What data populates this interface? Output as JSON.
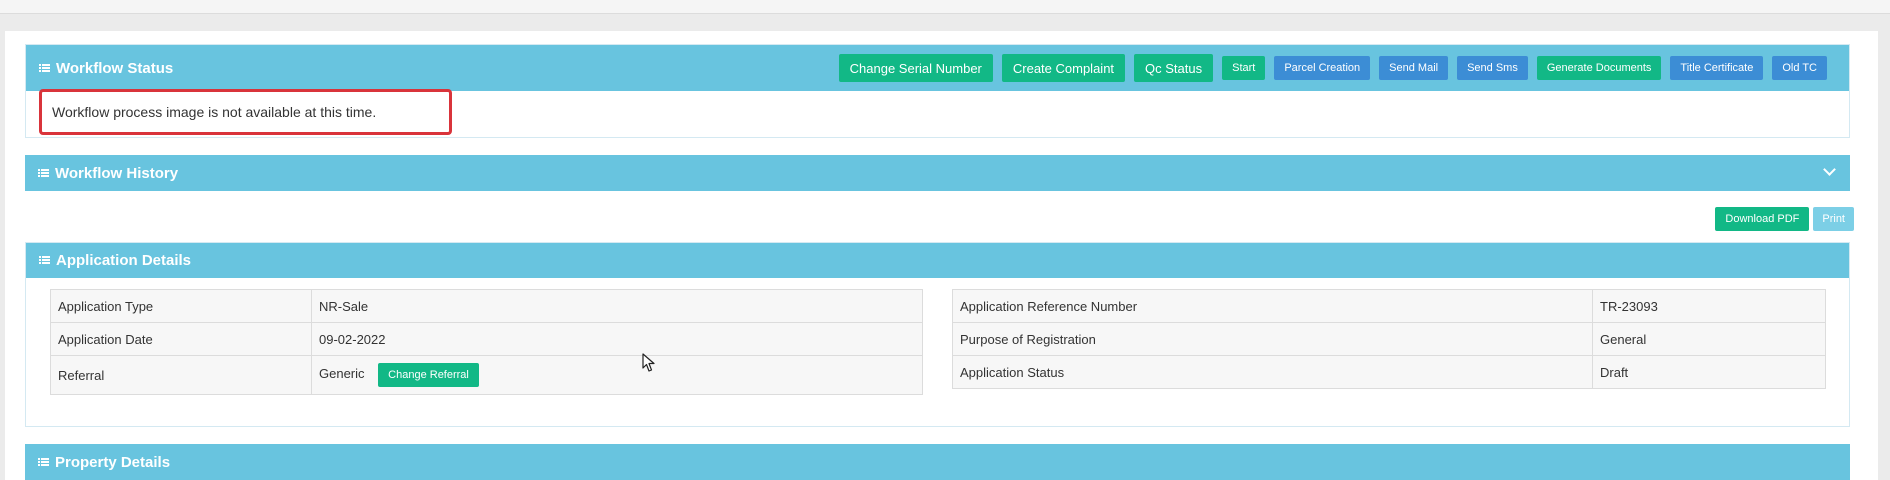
{
  "workflow_status": {
    "title": "Workflow Status",
    "message": "Workflow process image is not available at this time.",
    "buttons": {
      "change_serial": "Change Serial Number",
      "create_complaint": "Create Complaint",
      "qc_status": "Qc Status",
      "start": "Start",
      "parcel_creation": "Parcel Creation",
      "send_mail": "Send Mail",
      "send_sms": "Send Sms",
      "generate_documents": "Generate Documents",
      "title_certificate": "Title Certificate",
      "old_tc": "Old TC"
    }
  },
  "workflow_history": {
    "title": "Workflow History",
    "toggle_icon": "chevron-down-icon"
  },
  "doc_actions": {
    "download_pdf": "Download PDF",
    "print": "Print"
  },
  "application_details": {
    "title": "Application Details",
    "left": [
      {
        "label": "Application Type",
        "value": "NR-Sale"
      },
      {
        "label": "Application Date",
        "value": "09-02-2022"
      },
      {
        "label": "Referral",
        "value": "Generic",
        "action": "Change Referral"
      }
    ],
    "right": [
      {
        "label": "Application Reference Number",
        "value": "TR-23093"
      },
      {
        "label": "Purpose of Registration",
        "value": "General"
      },
      {
        "label": "Application Status",
        "value": "Draft"
      }
    ]
  },
  "property_details": {
    "title": "Property Details"
  },
  "colors": {
    "panel_header": "#68c4df",
    "green_button": "#12b886",
    "blue_button": "#3c8dd5",
    "highlight_border": "#d9343b"
  }
}
